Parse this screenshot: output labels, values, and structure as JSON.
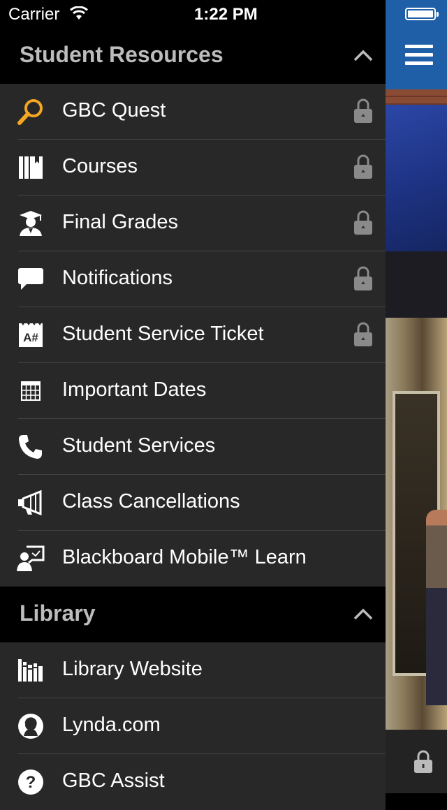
{
  "status_bar": {
    "carrier": "Carrier",
    "time": "1:22 PM"
  },
  "sections": [
    {
      "title": "Student Resources",
      "items": [
        {
          "label": "GBC Quest",
          "icon": "search-icon",
          "locked": true
        },
        {
          "label": "Courses",
          "icon": "books-icon",
          "locked": true
        },
        {
          "label": "Final Grades",
          "icon": "graduate-icon",
          "locked": true
        },
        {
          "label": "Notifications",
          "icon": "chat-bubble-icon",
          "locked": true
        },
        {
          "label": "Student Service Ticket",
          "icon": "ticket-icon",
          "icon_text": "A#",
          "locked": true
        },
        {
          "label": "Important Dates",
          "icon": "calendar-icon",
          "locked": false
        },
        {
          "label": "Student Services",
          "icon": "phone-icon",
          "locked": false
        },
        {
          "label": "Class Cancellations",
          "icon": "megaphone-icon",
          "locked": false
        },
        {
          "label": "Blackboard Mobile™ Learn",
          "icon": "presenter-icon",
          "locked": false
        }
      ]
    },
    {
      "title": "Library",
      "items": [
        {
          "label": "Library Website",
          "icon": "library-books-icon",
          "locked": false
        },
        {
          "label": "Lynda.com",
          "icon": "lynda-logo-icon",
          "locked": false
        },
        {
          "label": "GBC Assist",
          "icon": "question-icon",
          "icon_text": "?",
          "locked": false
        }
      ]
    }
  ],
  "colors": {
    "drawer_bg": "#282828",
    "header_bg": "#000000",
    "accent_orange": "#f5a623",
    "top_bar_blue": "#1f5fa8"
  }
}
